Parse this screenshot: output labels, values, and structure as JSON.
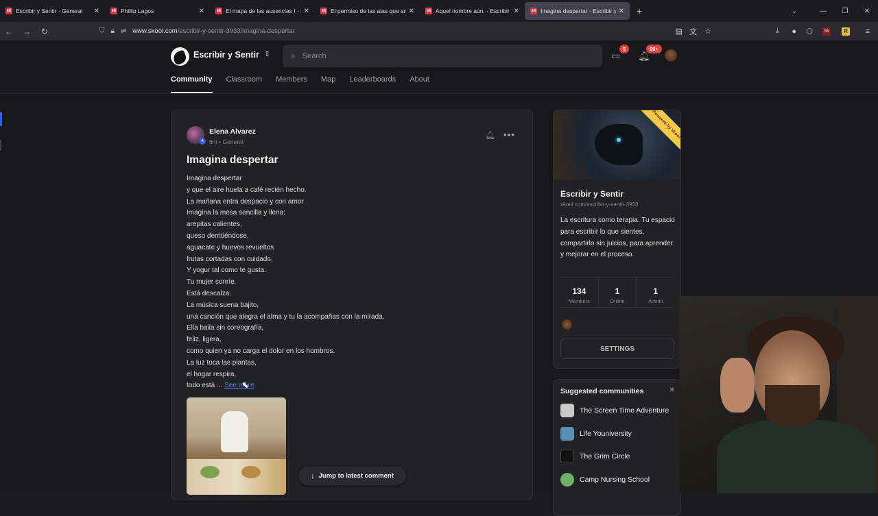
{
  "browser": {
    "tabs": [
      {
        "title": "Escribir y Sentir · General",
        "favicon": "sk"
      },
      {
        "title": "Phillip Lagos",
        "favicon": "sk"
      },
      {
        "title": "El mapa de las ausencias I - Escri",
        "favicon": "sk"
      },
      {
        "title": "El permiso de las alas que amé",
        "favicon": "sk"
      },
      {
        "title": "Aquel nombre aún. - Escribir y S",
        "favicon": "sk"
      },
      {
        "title": "Imagina despertar - Escribir y Se",
        "favicon": "sk",
        "active": true
      }
    ],
    "url_domain": "www.skool.com",
    "url_path": "/escribir-y-sentir-3933/imagina-despertar",
    "extension_badge": "55"
  },
  "header": {
    "community_name": "Escribir y Sentir",
    "search_placeholder": "Search",
    "chat_badge": "5",
    "notif_badge": "99+",
    "nav": [
      "Community",
      "Classroom",
      "Members",
      "Map",
      "Leaderboards",
      "About"
    ],
    "active_nav": "Community"
  },
  "post": {
    "author": "Elena Alvarez",
    "level": "4",
    "meta": "6m • General",
    "title": "Imagina despertar",
    "lines": [
      "Imagina despertar",
      "y que el aire huela a café recién hecho.",
      "La mañana entra despacio y con amor",
      "Imagina la mesa sencilla y llena:",
      "arepitas calientes,",
      "queso derritiéndose,",
      "aguacate y huevos revueltos",
      "frutas cortadas con cuidado,",
      "Y yogur tal como te gusta.",
      "Tu mujer sonríe.",
      "Está descalza.",
      "La música suena bajito,",
      "una canción que alegra el alma y tu la acompañas con la mirada.",
      "Ella baila sin coreografía,",
      "feliz, ligera,",
      "como quien ya no carga el dolor en los hombros.",
      "La luz toca las plantas,",
      "el hogar respira,"
    ],
    "last_line": "todo está ...",
    "see_more": "See more",
    "jump_label": "Jump to latest comment"
  },
  "sidebar": {
    "name": "Escribir y Sentir",
    "url": "skool.com/escribir-y-sentir-3933",
    "description": "La escritura como terapia. Tu espacio para escribir lo que sientes, compartirlo sin juicios, para aprender y mejorar en el proceso.",
    "ribbon": "Powered by skool",
    "stats": [
      {
        "num": "134",
        "label": "Members"
      },
      {
        "num": "1",
        "label": "Online"
      },
      {
        "num": "1",
        "label": "Admin"
      }
    ],
    "settings_label": "SETTINGS"
  },
  "suggested": {
    "title": "Suggested communities",
    "items": [
      {
        "name": "The Screen Time Adventure",
        "color": "#c9c9c9"
      },
      {
        "name": "Life Youniversity",
        "color": "#5a8fb5"
      },
      {
        "name": "The Grim Circle",
        "color": "#111111"
      },
      {
        "name": "Camp Nursing School",
        "color": "#6fae6a"
      }
    ]
  }
}
